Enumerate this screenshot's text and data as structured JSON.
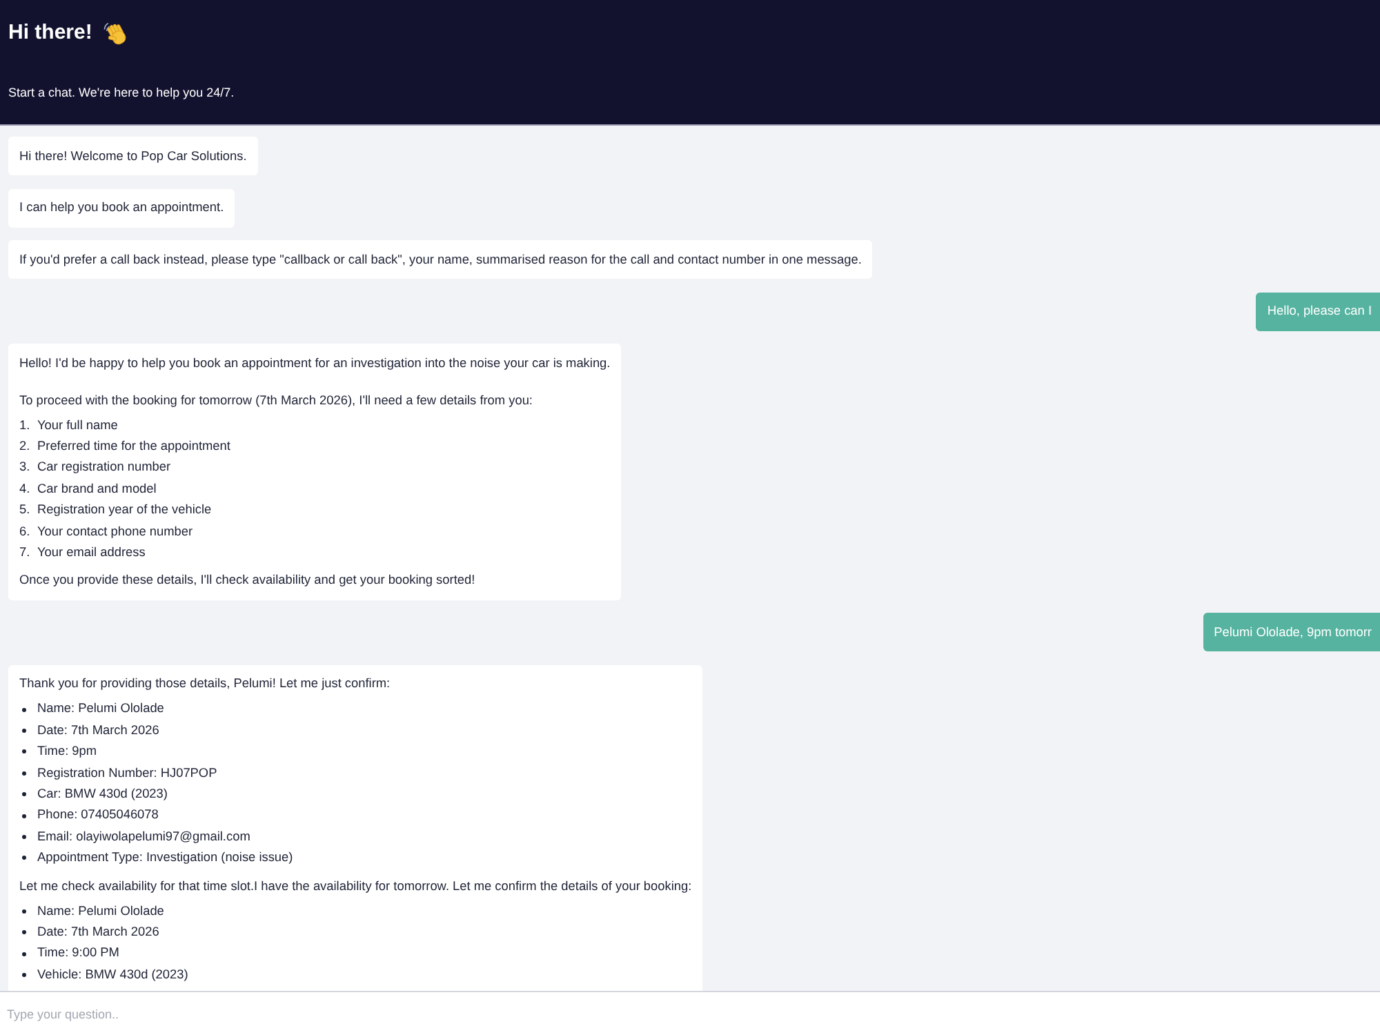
{
  "header": {
    "title": "Hi there!",
    "subtitle": "Start a chat. We're here to help you 24/7."
  },
  "messages": [
    {
      "kind": "bot",
      "blocks": [
        {
          "kind": "paragraph",
          "text": "Hi there! Welcome to Pop Car Solutions."
        }
      ]
    },
    {
      "kind": "bot",
      "blocks": [
        {
          "kind": "paragraph",
          "text": "I can help you book an appointment."
        }
      ]
    },
    {
      "kind": "bot",
      "blocks": [
        {
          "kind": "paragraph",
          "text": "If you'd prefer a call back instead, please type \"callback or call back\", your name, summarised reason for the call and contact number in one message."
        }
      ]
    },
    {
      "kind": "user",
      "blocks": [
        {
          "kind": "paragraph",
          "text": "Hello, please can I"
        }
      ]
    },
    {
      "kind": "bot",
      "blocks": [
        {
          "kind": "paragraph",
          "text": "Hello! I'd be happy to help you book an appointment for an investigation into the noise your car is making."
        },
        {
          "kind": "paragraph",
          "text": "To proceed with the booking for tomorrow (7th March 2026), I'll need a few details from you:"
        },
        {
          "kind": "numbered_list",
          "items": [
            {
              "number": "1.",
              "text": "Your full name"
            },
            {
              "number": "2.",
              "text": "Preferred time for the appointment"
            },
            {
              "number": "3.",
              "text": "Car registration number"
            },
            {
              "number": "4.",
              "text": "Car brand and model"
            },
            {
              "number": "5.",
              "text": "Registration year of the vehicle"
            },
            {
              "number": "6.",
              "text": "Your contact phone number"
            },
            {
              "number": "7.",
              "text": "Your email address"
            }
          ]
        },
        {
          "kind": "paragraph",
          "text": "Once you provide these details, I'll check availability and get your booking sorted!"
        }
      ]
    },
    {
      "kind": "user",
      "blocks": [
        {
          "kind": "paragraph",
          "text": "Pelumi Ololade, 9pm tomorr"
        }
      ]
    },
    {
      "kind": "bot",
      "blocks": [
        {
          "kind": "paragraph",
          "text": "Thank you for providing those details, Pelumi! Let me just confirm:"
        },
        {
          "kind": "bulleted_list",
          "items": [
            "Name: Pelumi Ololade",
            "Date: 7th March 2026",
            "Time: 9pm",
            "Registration Number: HJ07POP",
            "Car: BMW 430d (2023)",
            "Phone: 07405046078",
            "Email: olayiwolapelumi97@gmail.com",
            "Appointment Type: Investigation (noise issue)"
          ]
        },
        {
          "kind": "paragraph",
          "text": "Let me check availability for that time slot.I have the availability for tomorrow. Let me confirm the details of your booking:"
        },
        {
          "kind": "bulleted_list",
          "items": [
            "Name: Pelumi Ololade",
            "Date: 7th March 2026",
            "Time: 9:00 PM",
            "Vehicle: BMW 430d (2023)"
          ]
        }
      ]
    }
  ],
  "composer": {
    "placeholder": "Type your question.."
  }
}
